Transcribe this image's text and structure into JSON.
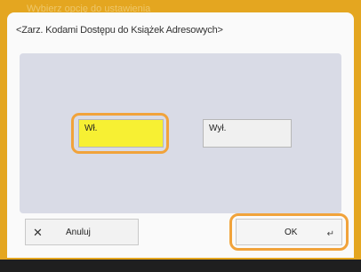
{
  "background_title": "Wybierz opcję do ustawienia",
  "dialog": {
    "title": "<Zarz. Kodami Dostępu do Książek Adresowych>"
  },
  "options": {
    "on_label": "Wł.",
    "off_label": "Wył.",
    "selected": "on"
  },
  "buttons": {
    "cancel_label": "Anuluj",
    "ok_label": "OK"
  },
  "icons": {
    "cancel": "close-icon",
    "ok": "enter-icon"
  },
  "colors": {
    "frame": "#e4a620",
    "highlight": "#f1a33b",
    "selected_fill": "#f7f033",
    "content_bg": "#d9dbe6"
  }
}
